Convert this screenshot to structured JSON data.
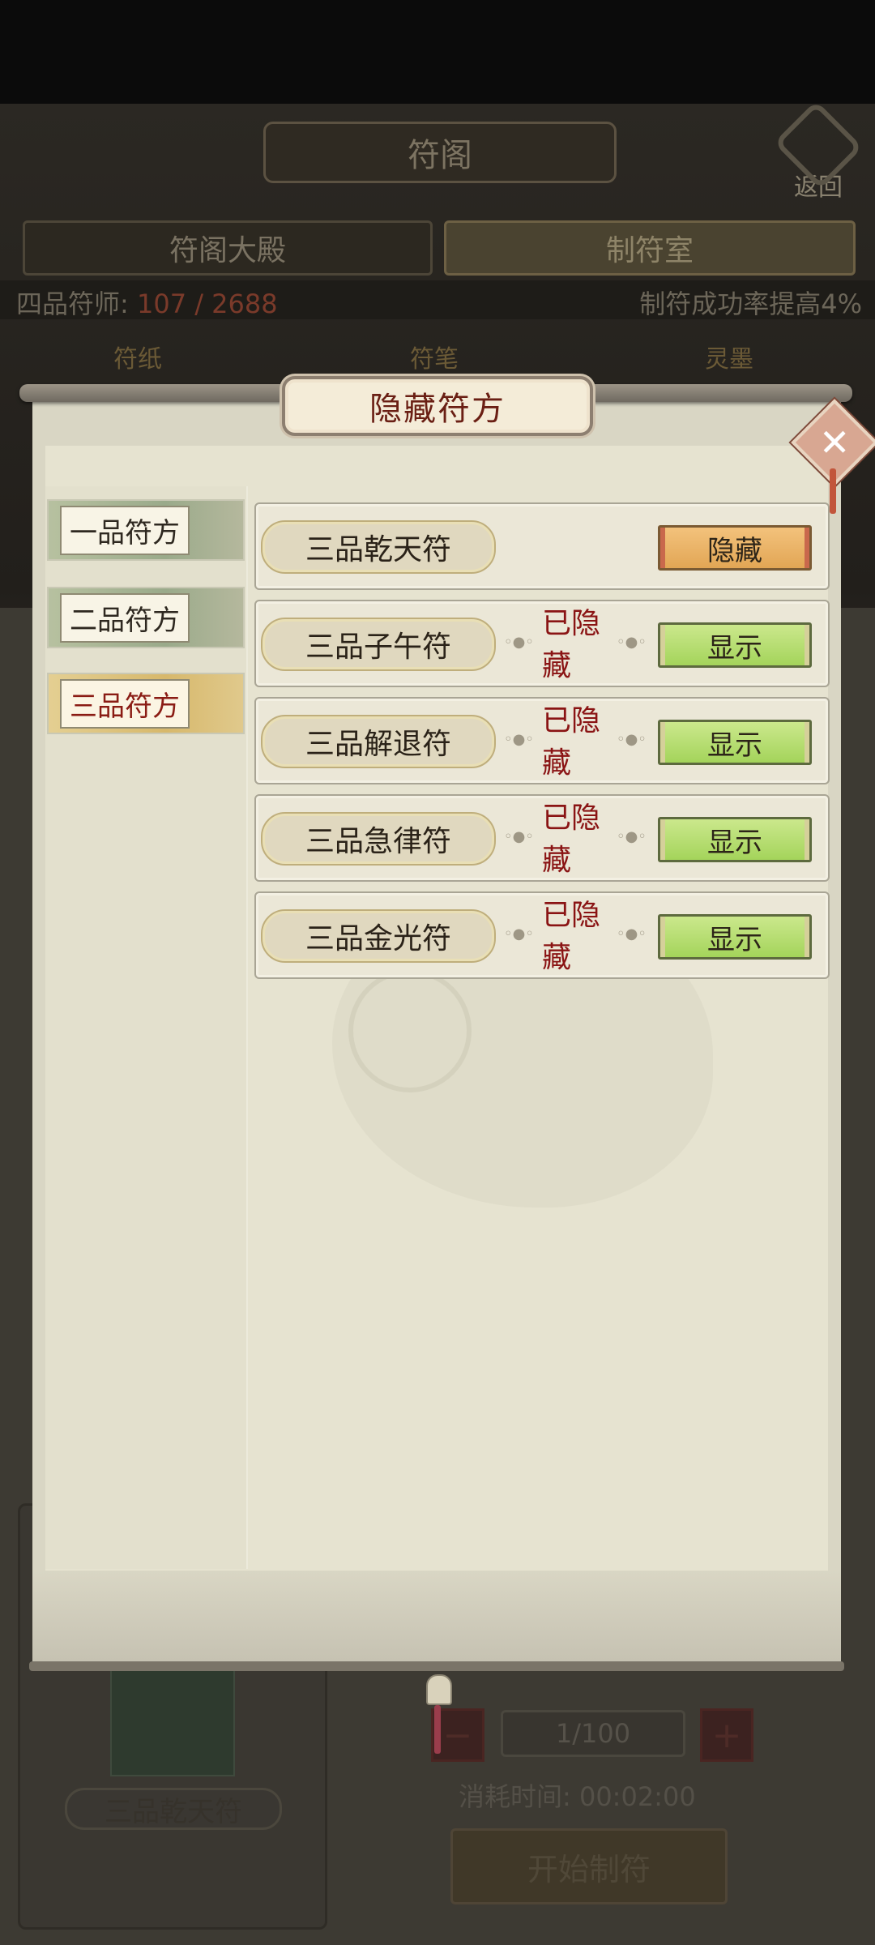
{
  "background": {
    "title": "符阁",
    "back_label": "返回",
    "tabs": [
      "符阁大殿",
      "制符室"
    ],
    "rank": "四品符师:",
    "progress_text": "107 / 2688",
    "success_bonus": "制符成功率提高4%",
    "categories": [
      "符纸",
      "符笔",
      "灵墨"
    ],
    "selected_item": "三品乾天符",
    "quantity": "1/100",
    "time_label": "消耗时间: 00:02:00",
    "start_button": "开始制符"
  },
  "modal": {
    "title": "隐藏符方",
    "close_icon": "close-icon",
    "category_tabs": [
      {
        "label": "一品符方",
        "active": false
      },
      {
        "label": "二品符方",
        "active": false
      },
      {
        "label": "三品符方",
        "active": true
      }
    ],
    "recipes": [
      {
        "name": "三品乾天符",
        "status": "",
        "action": "隐藏",
        "type": "hide"
      },
      {
        "name": "三品子午符",
        "status": "已隐藏",
        "action": "显示",
        "type": "show"
      },
      {
        "name": "三品解退符",
        "status": "已隐藏",
        "action": "显示",
        "type": "show"
      },
      {
        "name": "三品急律符",
        "status": "已隐藏",
        "action": "显示",
        "type": "show"
      },
      {
        "name": "三品金光符",
        "status": "已隐藏",
        "action": "显示",
        "type": "show"
      }
    ]
  },
  "colors": {
    "status_red": "#8a1414",
    "show_green": "#a4d45b",
    "hide_orange": "#e2a655"
  }
}
